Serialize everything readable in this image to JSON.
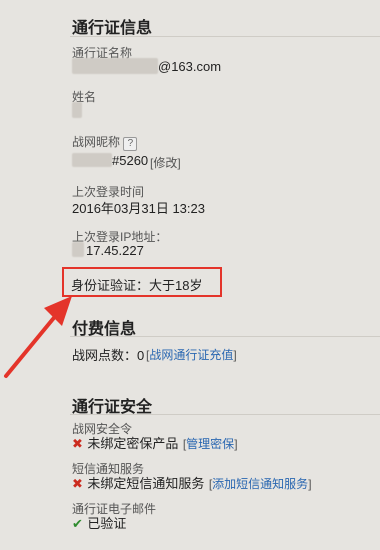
{
  "pass_info": {
    "heading": "通行证信息",
    "account_label": "通行证名称",
    "account_value": "@163.com",
    "name_label": "姓名",
    "nickname_label": "战网昵称",
    "nickname_help": "?",
    "nickname_value": "#5260",
    "modify_link": "修改",
    "last_login_label": "上次登录时间",
    "last_login_value": "2016年03月31日 13:23",
    "last_ip_label": "上次登录IP地址：",
    "last_ip_value": "17.45.227",
    "id_verify_text": "身份证验证：大于18岁"
  },
  "billing": {
    "heading": "付费信息",
    "points_text": "战网点数：0",
    "recharge_link": "战网通行证充值"
  },
  "security": {
    "heading": "通行证安全",
    "token_label": "战网安全令",
    "token_status": "未绑定密保产品",
    "token_link": "管理密保",
    "sms_label": "短信通知服务",
    "sms_status": "未绑定短信通知服务",
    "sms_link": "添加短信通知服务",
    "email_label": "通行证电子邮件",
    "email_status": "已验证"
  },
  "colors": {
    "annotation_red": "#e4342a",
    "link_blue": "#2a67b1",
    "error_red": "#cc2b1f",
    "ok_green": "#2e8b2e"
  },
  "icons": [
    "help-icon",
    "x-icon",
    "check-icon"
  ]
}
